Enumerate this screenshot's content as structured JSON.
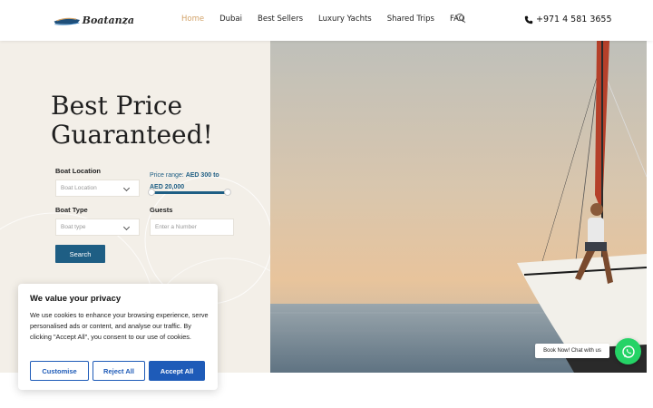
{
  "header": {
    "logo_text": "Boatanza",
    "nav": [
      {
        "label": "Home",
        "active": true
      },
      {
        "label": "Dubai",
        "active": false
      },
      {
        "label": "Best Sellers",
        "active": false
      },
      {
        "label": "Luxury Yachts",
        "active": false
      },
      {
        "label": "Shared Trips",
        "active": false
      },
      {
        "label": "FAQ",
        "active": false
      }
    ],
    "phone": "+971 4 581 3655"
  },
  "hero": {
    "title_line1": "Best Price",
    "title_line2": "Guaranteed!"
  },
  "search_form": {
    "boat_location_label": "Boat Location",
    "boat_location_value": "Boat Location",
    "price_range_prefix": "Price range:",
    "price_range_min": "AED 300",
    "price_range_mid": "to",
    "price_range_max": "AED 20,000",
    "price_slider_min_fraction": 0.0,
    "price_slider_max_fraction": 1.0,
    "boat_type_label": "Boat Type",
    "boat_type_value": "Boat type",
    "guests_label": "Guests",
    "guests_placeholder": "Enter a Number",
    "search_label": "Search"
  },
  "cookie": {
    "title": "We value your privacy",
    "text": "We use cookies to enhance your browsing experience, serve personalised ads or content, and analyse our traffic. By clicking \"Accept All\", you consent to our use of cookies.",
    "customise": "Customise",
    "reject": "Reject All",
    "accept": "Accept All"
  },
  "whatsapp": {
    "bubble": "Book Now! Chat with us"
  },
  "colors": {
    "accent": "#1e5e84",
    "nav_active": "#d2a36a",
    "cookie_button": "#1e5bb8",
    "whatsapp": "#25d366"
  },
  "icons": [
    "logo-boat-icon",
    "search-icon",
    "phone-icon",
    "chevron-down-icon",
    "whatsapp-icon"
  ]
}
